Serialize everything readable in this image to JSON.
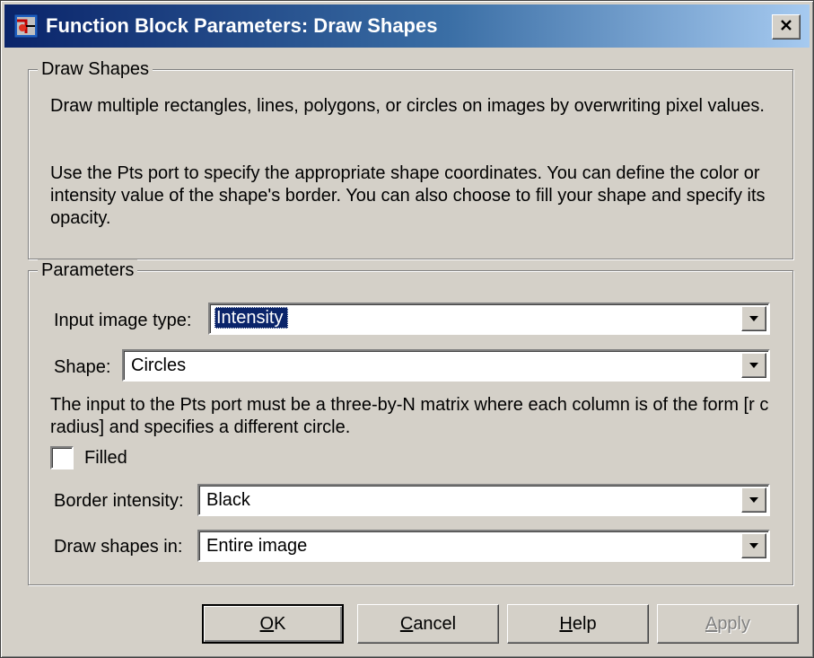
{
  "window": {
    "title": "Function Block Parameters: Draw Shapes",
    "icon": "simulink-block-icon",
    "close_icon": "close-icon"
  },
  "description_group": {
    "legend": "Draw Shapes",
    "para1": "Draw multiple rectangles, lines, polygons, or circles on images by overwriting pixel values.",
    "para2": "Use the Pts port to specify the appropriate shape coordinates. You can define the color or intensity value of the shape's border. You can also choose to fill your shape and specify its opacity."
  },
  "parameters_group": {
    "legend": "Parameters",
    "input_image_type": {
      "label": "Input image type:",
      "value": "Intensity"
    },
    "shape": {
      "label": "Shape:",
      "value": "Circles"
    },
    "pts_note": "The input to the Pts port must be a three-by-N matrix where each column is of the form [r c radius] and specifies a different circle.",
    "filled": {
      "label": "Filled",
      "checked": false
    },
    "border_intensity": {
      "label": "Border intensity:",
      "value": "Black"
    },
    "draw_shapes_in": {
      "label": "Draw shapes in:",
      "value": "Entire image"
    }
  },
  "buttons": {
    "ok": {
      "mnemonic": "O",
      "rest": "K"
    },
    "cancel": {
      "mnemonic": "C",
      "rest": "ancel"
    },
    "help": {
      "mnemonic": "H",
      "rest": "elp"
    },
    "apply": {
      "mnemonic": "A",
      "rest": "pply",
      "enabled": false
    }
  },
  "colors": {
    "title_start": "#0a246a",
    "title_end": "#a6caf0",
    "face": "#d4d0c8",
    "selection": "#0a246a"
  }
}
